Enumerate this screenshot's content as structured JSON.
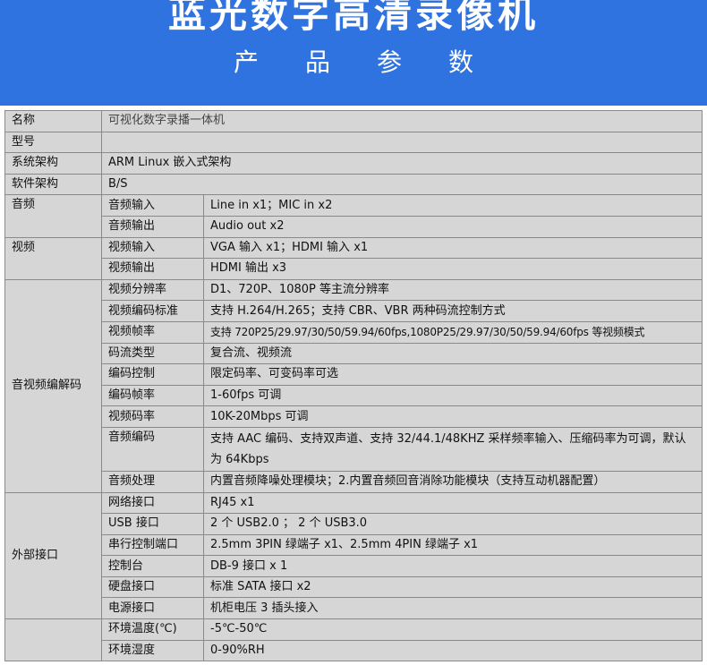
{
  "banner": {
    "title": "蓝光数字高清录像机",
    "subtitle": [
      "产",
      "品",
      "参",
      "数"
    ],
    "color": "#2f73e0"
  },
  "specs": {
    "name_label": "名称",
    "name_value": "可视化数字录播一体机",
    "model_label": "型号",
    "model_value": "",
    "arch_label": "系统架构",
    "arch_value": "ARM Linux 嵌入式架构",
    "soft_label": "软件架构",
    "soft_value": "B/S",
    "audio": {
      "group": "音频",
      "rows": [
        {
          "label": "音频输入",
          "value": "Line in x1；MIC in x2"
        },
        {
          "label": "音频输出",
          "value": "Audio out x2"
        }
      ]
    },
    "video": {
      "group": "视频",
      "rows": [
        {
          "label": "视频输入",
          "value": "VGA 输入 x1；HDMI 输入 x1"
        },
        {
          "label": "视频输出",
          "value": "HDMI 输出 x3"
        }
      ]
    },
    "codec": {
      "group": "音视频编解码",
      "rows": [
        {
          "label": "视频分辨率",
          "value": "D1、720P、1080P 等主流分辨率"
        },
        {
          "label": "视频编码标准",
          "value": "支持 H.264/H.265；支持 CBR、VBR 两种码流控制方式"
        },
        {
          "label": "视频帧率",
          "value": "支持 720P25/29.97/30/50/59.94/60fps,1080P25/29.97/30/50/59.94/60fps 等视频模式"
        },
        {
          "label": "码流类型",
          "value": "复合流、视频流"
        },
        {
          "label": "编码控制",
          "value": "限定码率、可变码率可选"
        },
        {
          "label": "编码帧率",
          "value": "1-60fps 可调"
        },
        {
          "label": "视频码率",
          "value": "10K-20Mbps 可调"
        },
        {
          "label": "音频编码",
          "value": "支持 AAC 编码、支持双声道、支持 32/44.1/48KHZ 采样频率输入、压缩码率为可调，默认为 64Kbps"
        },
        {
          "label": "音频处理",
          "value": "内置音频降噪处理模块；2.内置音频回音消除功能模块（支持互动机器配置）"
        }
      ]
    },
    "ports": {
      "group": "外部接口",
      "rows": [
        {
          "label": "网络接口",
          "value": "RJ45 x1"
        },
        {
          "label": "USB 接口",
          "value": "2 个 USB2.0 ； 2 个 USB3.0"
        },
        {
          "label": "串行控制端口",
          "value": "2.5mm 3PIN 绿端子 x1、2.5mm 4PIN 绿端子 x1"
        },
        {
          "label": "控制台",
          "value": "DB-9 接口 x 1"
        },
        {
          "label": "硬盘接口",
          "value": "标准 SATA 接口 x2"
        },
        {
          "label": "电源接口",
          "value": "机柜电压 3 插头接入"
        }
      ]
    },
    "env": {
      "group": "",
      "rows": [
        {
          "label": "环境温度(℃)",
          "value": "-5℃-50℃"
        },
        {
          "label": "环境湿度",
          "value": "0-90%RH"
        }
      ]
    }
  }
}
